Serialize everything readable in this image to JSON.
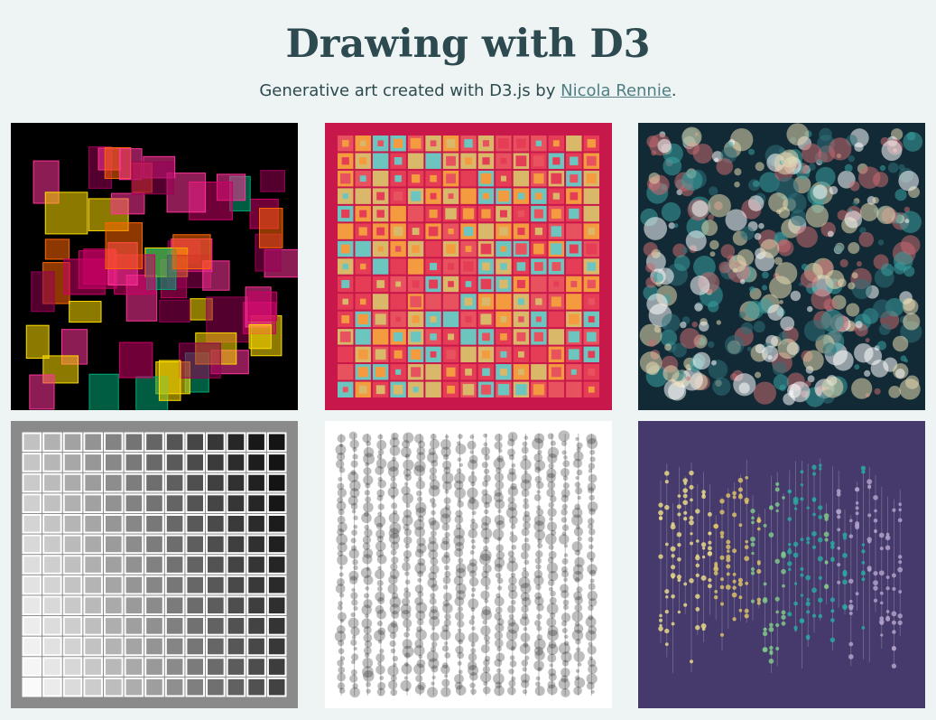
{
  "page": {
    "title": "Drawing with D3",
    "subtitle_prefix": "Generative art created with D3.js by ",
    "author_link": "Nicola Rennie",
    "subtitle_suffix": "."
  },
  "gallery": {
    "items": [
      {
        "id": "random-rectangles",
        "background": "#000000"
      },
      {
        "id": "nested-squares-grid",
        "background": "#c8174a"
      },
      {
        "id": "bokeh-circles",
        "background": "#112a35"
      },
      {
        "id": "grayscale-grid",
        "background": "#8a8a8a"
      },
      {
        "id": "dot-columns",
        "background": "#ffffff"
      },
      {
        "id": "dot-lines",
        "background": "#453a6b"
      }
    ]
  },
  "colors": {
    "rectangles": [
      "#cc0066",
      "#ff3399",
      "#ffdd00",
      "#ff6600",
      "#00aa77",
      "#990055"
    ],
    "squares": [
      "#e63d56",
      "#f49b3f",
      "#6dc5c0",
      "#d9b86a",
      "#e8525e"
    ],
    "bokeh": [
      "#3aa0a0",
      "#e8d8b0",
      "#c96a70",
      "#ffffff",
      "#2f6f78"
    ],
    "lines": [
      "#e6d88a",
      "#d8c06a",
      "#7fc58a",
      "#2aa8a0",
      "#b0a0c8"
    ]
  }
}
